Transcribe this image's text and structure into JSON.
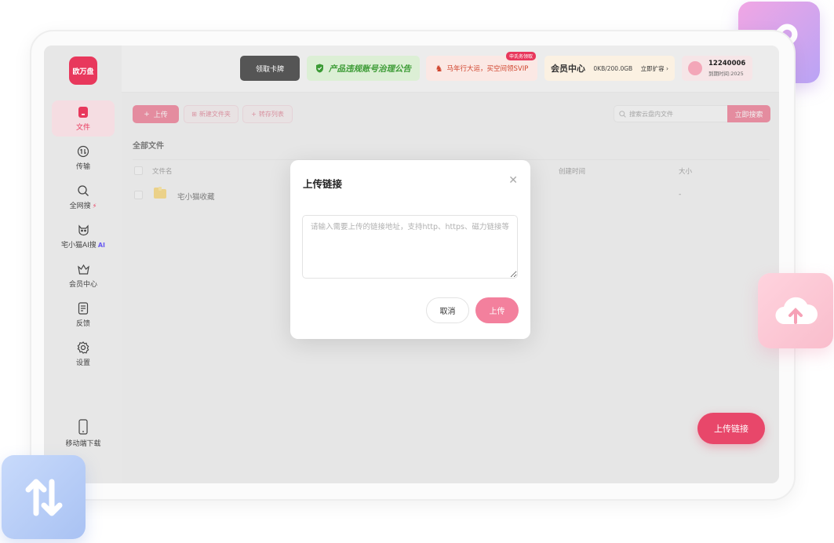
{
  "app": {
    "logo_text": "欧万盘"
  },
  "sidebar": {
    "items": [
      {
        "label": "文件",
        "icon": "file-icon",
        "active": true
      },
      {
        "label": "传输",
        "icon": "transfer-icon"
      },
      {
        "label": "全网搜",
        "icon": "search-icon",
        "badge": "⚡"
      },
      {
        "label": "宅小猫AI搜",
        "icon": "cat-icon",
        "badge": "AI"
      },
      {
        "label": "会员中心",
        "icon": "crown-icon"
      },
      {
        "label": "反馈",
        "icon": "feedback-icon"
      },
      {
        "label": "设置",
        "icon": "gear-icon"
      }
    ],
    "mobile_download": "移动端下载"
  },
  "topbar": {
    "card_banner": "领取卡牌",
    "notice_banner": "产品违规账号治理公告",
    "promo_banner": "马年行大运，买空间领SVIP",
    "promo_tag": "申氏务领取",
    "member_title": "会员中心",
    "storage": "0KB/200.0GB",
    "expand_link": "立即扩容 ›",
    "user_name": "12240006",
    "user_expire": "到期时间:2025"
  },
  "toolbar": {
    "upload": "上传",
    "new_folder": "新建文件夹",
    "transfer_list": "转存列表",
    "search_placeholder": "搜索云盘内文件",
    "search_button": "立即搜索"
  },
  "files": {
    "title": "全部文件",
    "columns": {
      "name": "文件名",
      "created": "创建时间",
      "size": "大小"
    },
    "rows": [
      {
        "name": "宅小猫收藏",
        "created": "",
        "size": "-"
      }
    ]
  },
  "float_upload": "上传链接",
  "modal": {
    "title": "上传链接",
    "placeholder": "请输入需要上传的链接地址，支持http、https、磁力链接等",
    "cancel": "取消",
    "confirm": "上传"
  },
  "colors": {
    "accent": "#e8476a",
    "accent_light": "#f3809d"
  }
}
